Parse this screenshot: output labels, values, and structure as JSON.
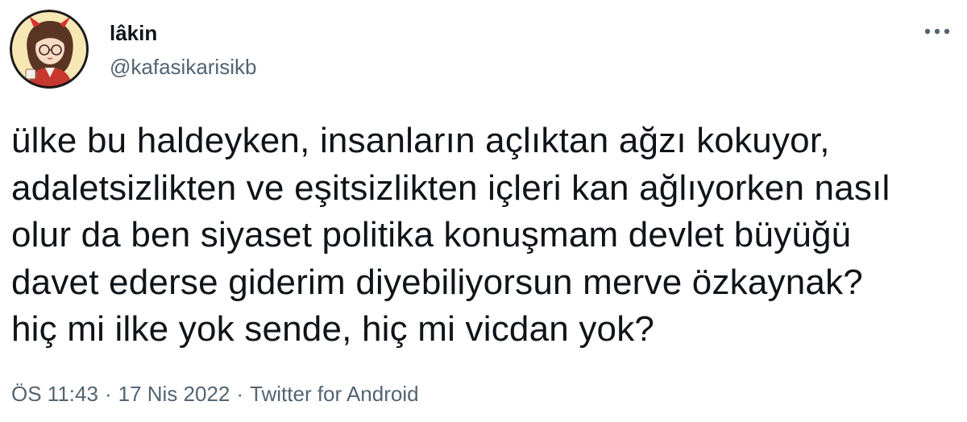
{
  "user": {
    "display_name": "lâkin",
    "handle": "@kafasikarisikb",
    "avatar_icon": "cartoon-avatar-with-devil-horns"
  },
  "tweet": {
    "lines": [
      "ülke bu haldeyken, insanların açlıktan ağzı kokuyor,",
      "adaletsizlikten ve eşitsizlikten içleri kan ağlıyorken nasıl",
      "olur da ben siyaset politika konuşmam devlet büyüğü",
      "davet ederse giderim diyebiliyorsun merve özkaynak?",
      "hiç mi ilke yok sende, hiç mi vicdan yok?"
    ]
  },
  "meta": {
    "time": "ÖS 11:43",
    "separator": "·",
    "date": "17 Nis 2022",
    "source": "Twitter for Android"
  },
  "actions": {
    "more_icon": "more-horizontal-icon"
  },
  "colors": {
    "text_primary": "#0f1419",
    "text_secondary": "#536471",
    "background": "#ffffff"
  }
}
